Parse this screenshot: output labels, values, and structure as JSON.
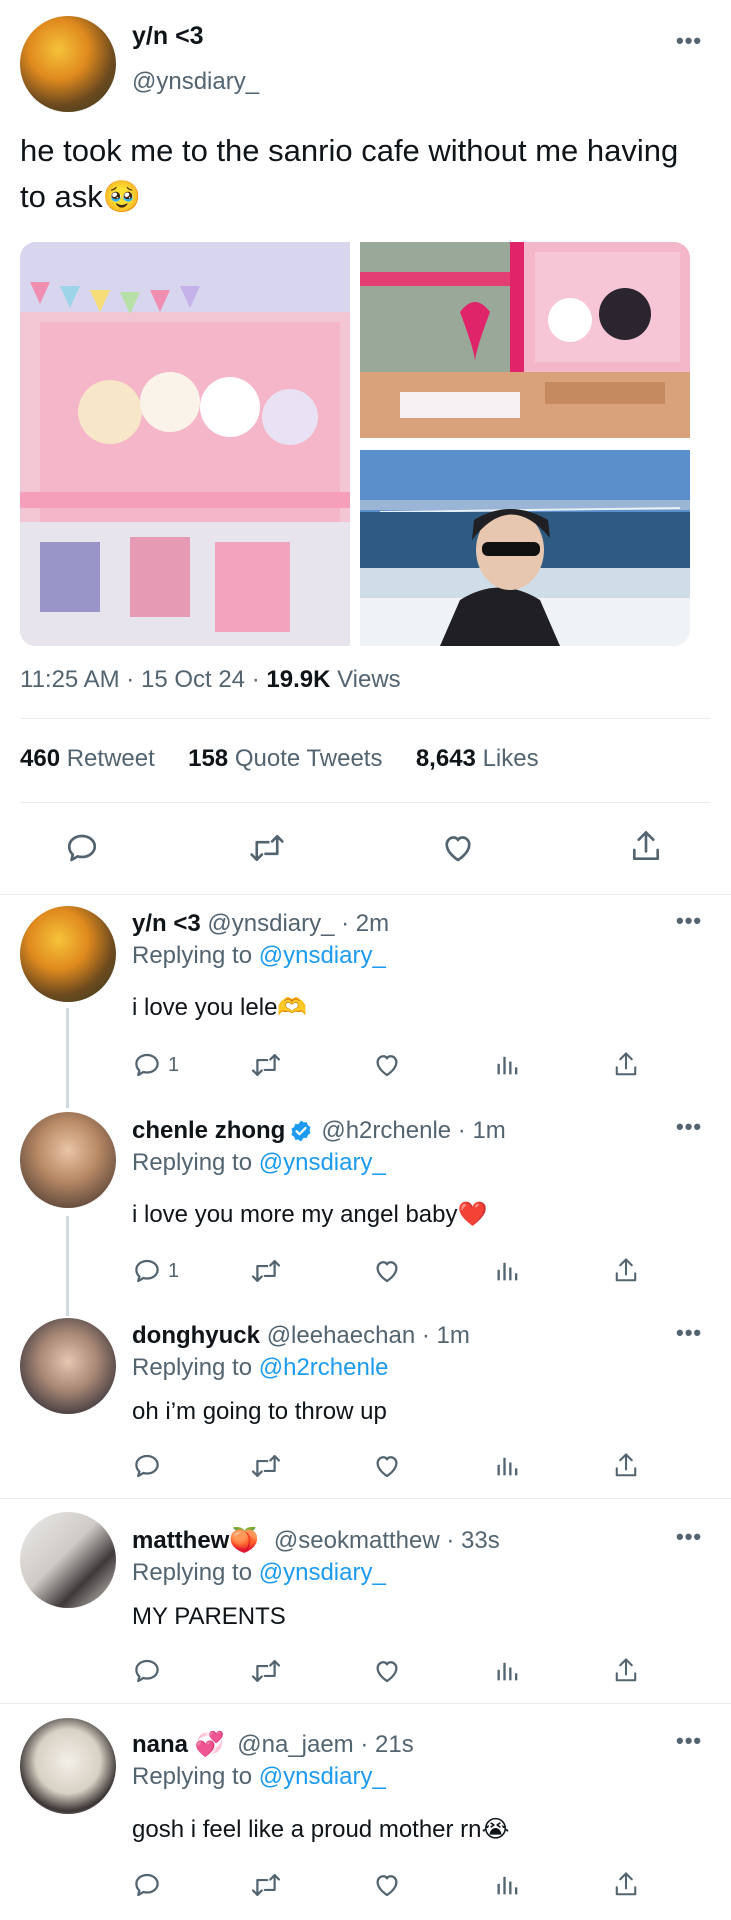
{
  "tweet": {
    "author_name": "y/n <3",
    "author_handle": "@ynsdiary_",
    "text": "he took me to the sanrio cafe without me having to ask",
    "text_emoji": "🥹",
    "time": "11:25 AM",
    "date": "15 Oct 24",
    "views_count": "19.9K",
    "views_label": "Views",
    "retweets_count": "460",
    "retweets_label": "Retweet",
    "quotes_count": "158",
    "quotes_label": "Quote Tweets",
    "likes_count": "8,643",
    "likes_label": "Likes"
  },
  "replies": [
    {
      "name": "y/n <3",
      "name_emoji": "",
      "handle": "@ynsdiary_",
      "time": "2m",
      "replying_to_label": "Replying to",
      "replying_to": "@ynsdiary_",
      "text": "i love you lele",
      "text_emoji": "🫶",
      "reply_count": "1",
      "verified": false
    },
    {
      "name": "chenle zhong",
      "name_emoji": "",
      "handle": "@h2rchenle",
      "time": "1m",
      "replying_to_label": "Replying to",
      "replying_to": "@ynsdiary_",
      "text": "i love you more my angel baby",
      "text_emoji": "❤️",
      "reply_count": "1",
      "verified": true
    },
    {
      "name": "donghyuck",
      "name_emoji": "",
      "handle": "@leehaechan",
      "time": "1m",
      "replying_to_label": "Replying to",
      "replying_to": "@h2rchenle",
      "text": "oh i’m going to throw up",
      "text_emoji": "",
      "reply_count": "",
      "verified": false
    },
    {
      "name": "matthew",
      "name_emoji": "🍑",
      "handle": "@seokmatthew",
      "time": "33s",
      "replying_to_label": "Replying to",
      "replying_to": "@ynsdiary_",
      "text": "MY PARENTS",
      "text_emoji": "",
      "reply_count": "",
      "verified": false
    },
    {
      "name": "nana",
      "name_emoji": "💞",
      "handle": "@na_jaem",
      "time": "21s",
      "replying_to_label": "Replying to",
      "replying_to": "@ynsdiary_",
      "text": "gosh i feel like a proud mother rn",
      "text_emoji": "😭",
      "reply_count": "",
      "verified": false
    }
  ],
  "icons": {
    "reply": "reply-icon",
    "retweet": "retweet-icon",
    "like": "heart-icon",
    "views": "views-icon",
    "share": "share-icon",
    "more": "more-icon",
    "verified": "verified-badge-icon"
  },
  "colors": {
    "link": "#1d9bf0",
    "muted": "#536471",
    "divider": "#e6ecf0",
    "verified": "#1d9bf0"
  }
}
